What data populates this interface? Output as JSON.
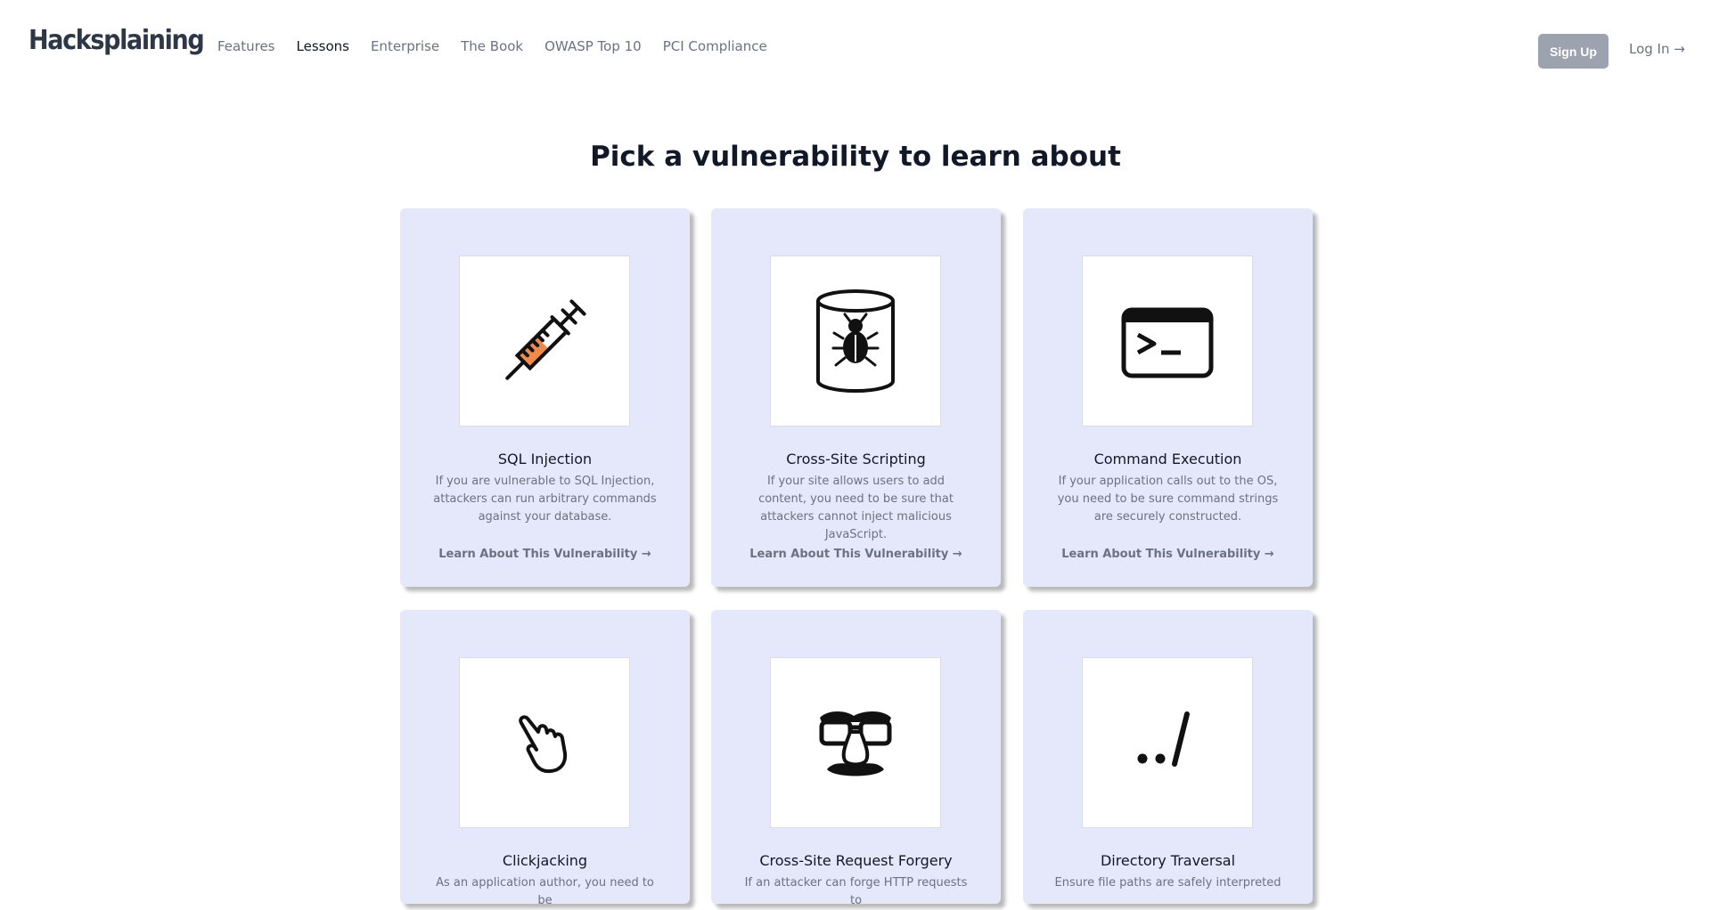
{
  "brand": {
    "logo": "Hacksplaining"
  },
  "nav": {
    "items": [
      {
        "label": "Features",
        "active": false
      },
      {
        "label": "Lessons",
        "active": true
      },
      {
        "label": "Enterprise",
        "active": false
      },
      {
        "label": "The Book",
        "active": false
      },
      {
        "label": "OWASP Top 10",
        "active": false
      },
      {
        "label": "PCI Compliance",
        "active": false
      }
    ],
    "signup": "Sign Up",
    "login": "Log In →"
  },
  "main": {
    "title": "Pick a vulnerability to learn about",
    "cards": [
      {
        "title": "SQL Injection",
        "description": "If you are vulnerable to SQL Injection, attackers can run arbitrary commands against your database.",
        "link": "Learn About This Vulnerability →",
        "icon": "syringe-icon"
      },
      {
        "title": "Cross-Site Scripting",
        "description": "If your site allows users to add content, you need to be sure that attackers cannot inject malicious JavaScript.",
        "link": "Learn About This Vulnerability →",
        "icon": "database-bug-icon"
      },
      {
        "title": "Command Execution",
        "description": "If your application calls out to the OS, you need to be sure command strings are securely constructed.",
        "link": "Learn About This Vulnerability →",
        "icon": "terminal-icon"
      },
      {
        "title": "Clickjacking",
        "description": "As an application author, you need to be",
        "icon": "pointing-hand-icon"
      },
      {
        "title": "Cross-Site Request Forgery",
        "description": "If an attacker can forge HTTP requests to",
        "icon": "disguise-glasses-icon"
      },
      {
        "title": "Directory Traversal",
        "description": "Ensure file paths are safely interpreted",
        "icon": "dot-dot-slash-icon"
      }
    ]
  },
  "colors": {
    "card_bg": "#e5e7fb",
    "syringe_fill": "#f08a4b",
    "signup_bg": "#9ca3af"
  }
}
